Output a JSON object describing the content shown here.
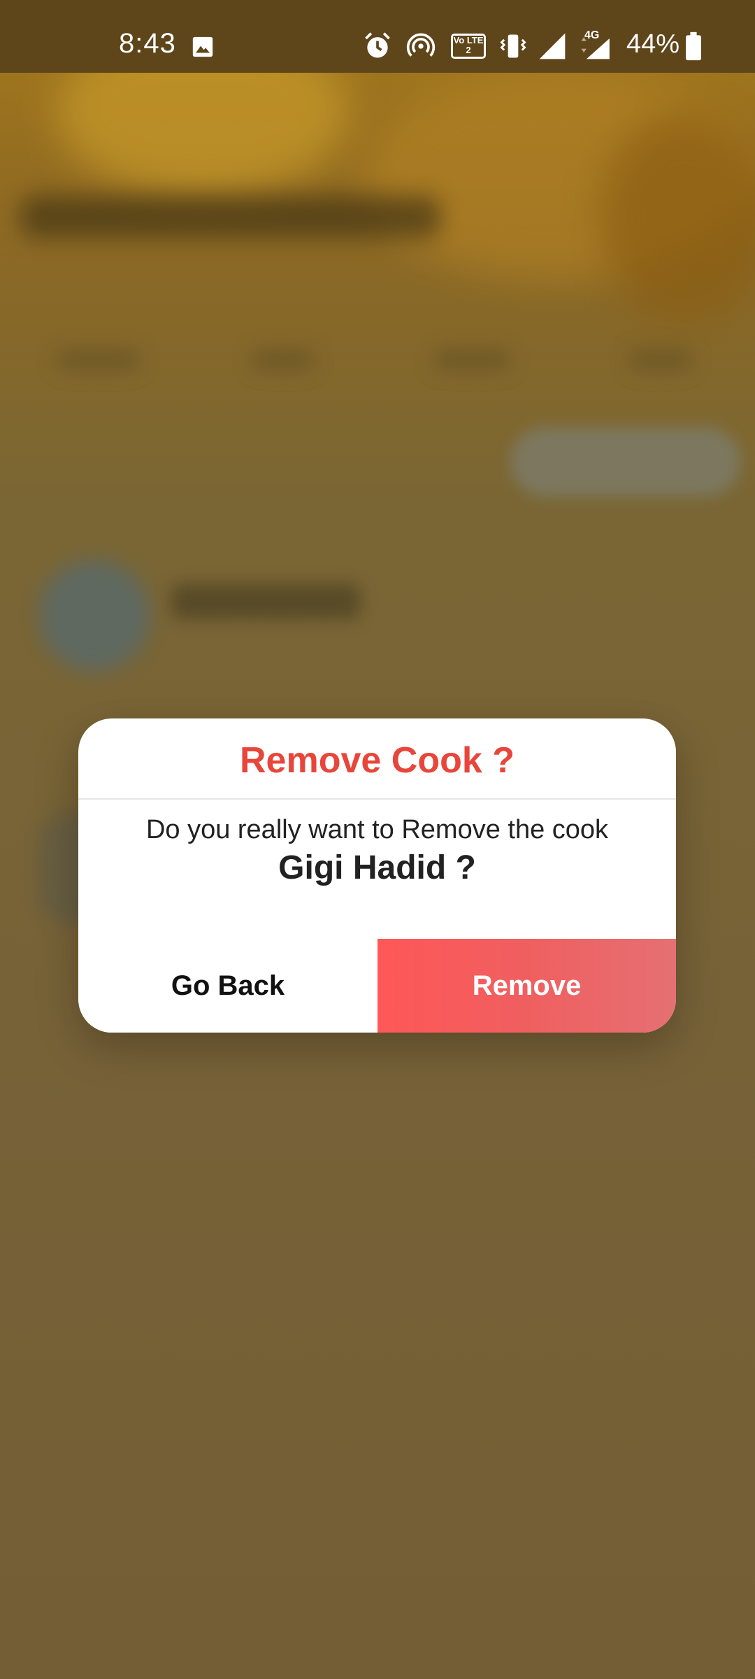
{
  "status_bar": {
    "time": "8:43",
    "volte_label": "Vo LTE 2",
    "network_label": "4G",
    "battery_percent": "44%",
    "icons": [
      "image-icon",
      "alarm-icon",
      "hotspot-icon",
      "volte-icon",
      "vibrate-icon",
      "signal-icon",
      "signal-4g-icon",
      "battery-icon"
    ]
  },
  "dialog": {
    "title": "Remove Cook ?",
    "message": "Do you really want to Remove the cook",
    "cook_name": "Gigi Hadid ?",
    "go_back_label": "Go Back",
    "remove_label": "Remove"
  },
  "colors": {
    "title": "#e8463a",
    "remove_button": "#ff5757",
    "overlay": "#77613a",
    "status_bar": "#5e451a"
  }
}
